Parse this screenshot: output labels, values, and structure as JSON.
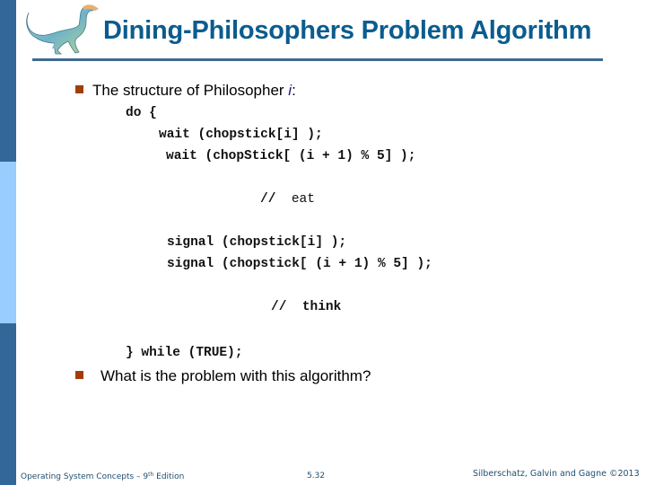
{
  "slide": {
    "title": "Dining-Philosophers Problem Algorithm",
    "colors": {
      "title": "#0b5c8e",
      "sidebar_dark": "#336699",
      "sidebar_light": "#99ccff",
      "bullet": "#a23d0b",
      "footer": "#1f4e6e"
    },
    "logo_icon": "dinosaur-logo",
    "bullets": [
      {
        "text": "The structure of Philosopher ",
        "italic_suffix": "i",
        "trailing": ":"
      },
      {
        "text": "What is the problem with this algorithm?"
      }
    ],
    "code": {
      "line1": "do {",
      "line2": "wait (chopstick[i] );",
      "line3": "wait (chopStick[ (i + 1) % 5] );",
      "comment_eat_slash": "//",
      "comment_eat_word": "eat",
      "line5": "signal (chopstick[i] );",
      "line6": "signal (chopstick[ (i + 1) % 5] );",
      "comment_think_slash": "//",
      "comment_think_word": "think",
      "line8": "} while (TRUE);"
    },
    "footer": {
      "left_prefix": "Operating System Concepts – 9",
      "left_sup": "th",
      "left_suffix": " Edition",
      "page": "5.32",
      "right": "Silberschatz, Galvin and Gagne ©2013"
    }
  }
}
